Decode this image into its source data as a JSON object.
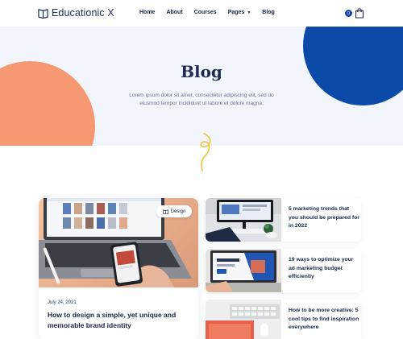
{
  "brand": {
    "name": "Educationic X"
  },
  "nav": {
    "home": "Home",
    "about": "About",
    "courses": "Courses",
    "pages": "Pages",
    "blog": "Blog"
  },
  "cart": {
    "count": "0"
  },
  "hero": {
    "title": "Blog",
    "subtitle": "Lorem ipsum dolor sit amet, consectetur adipiscing elit, sed do eiusmod tempor incididunt ut labore et dolore magna."
  },
  "featured": {
    "tag": "Design",
    "date": "July 24, 2021",
    "title": "How to design a simple, yet unique and memorable brand identity"
  },
  "posts": [
    {
      "title": "5 marketing trends that you should be prepared for in 2022"
    },
    {
      "title": "19 ways to optimize your ad marketing budget efficiently"
    },
    {
      "title": "How to be more creative: 5 cool tips to find inspiration everywhere"
    }
  ],
  "colors": {
    "primary": "#0b4aa8",
    "accent": "#f69872",
    "hero_bg": "#f2f5fb",
    "squiggle": "#f5c338",
    "text": "#15254a"
  }
}
